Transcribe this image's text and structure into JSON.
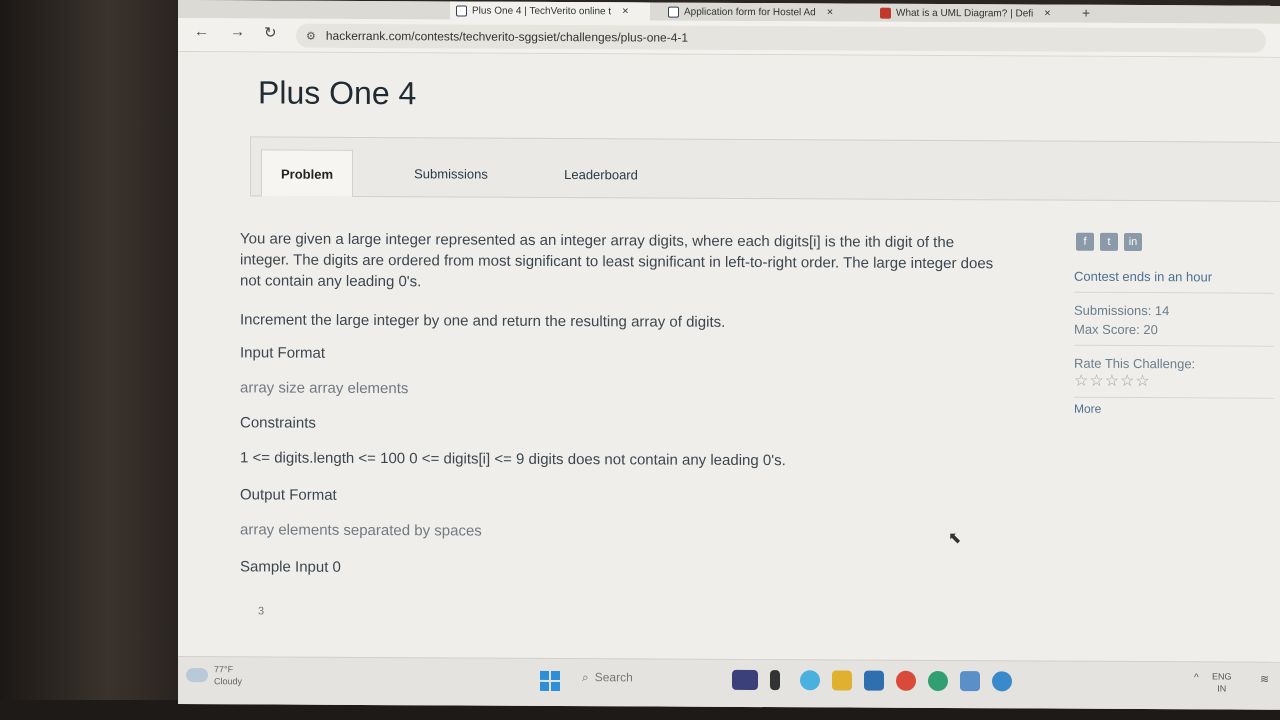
{
  "browser": {
    "tabs": [
      {
        "title": "Plus One 4 | TechVerito online t",
        "active": true
      },
      {
        "title": "Application form for Hostel Ad",
        "active": false
      },
      {
        "title": "What is a UML Diagram? | Defi",
        "active": false
      }
    ],
    "new_tab_label": "+",
    "close_glyph": "×",
    "url": "hackerrank.com/contests/techverito-sggsiet/challenges/plus-one-4-1"
  },
  "page": {
    "title": "Plus One 4",
    "tabs": [
      {
        "label": "Problem",
        "active": true
      },
      {
        "label": "Submissions",
        "active": false
      },
      {
        "label": "Leaderboard",
        "active": false
      }
    ],
    "description": "You are given a large integer represented as an integer array digits, where each digits[i] is the ith digit of the integer. The digits are ordered from most significant to least significant in left-to-right order. The large integer does not contain any leading 0's.",
    "task": "Increment the large integer by one and return the resulting array of digits.",
    "input_format_heading": "Input Format",
    "input_format_text": "array size array elements",
    "constraints_heading": "Constraints",
    "constraints_text": "1 <= digits.length <= 100 0 <= digits[i] <= 9 digits does not contain any leading 0's.",
    "output_format_heading": "Output Format",
    "output_format_text": "array elements separated by spaces",
    "sample_input_heading": "Sample Input 0",
    "sample_input_value": "3"
  },
  "sidebar": {
    "social_icons": [
      "facebook-icon",
      "twitter-icon",
      "linkedin-icon"
    ],
    "contest_ends": "Contest ends in an hour",
    "submissions": "Submissions: 14",
    "max_score": "Max Score: 20",
    "rate_label": "Rate This Challenge:",
    "stars": "☆☆☆☆☆",
    "more_link": "More"
  },
  "taskbar": {
    "temperature": "77°F",
    "weather": "Cloudy",
    "search_placeholder": "Search",
    "language": "ENG",
    "region": "IN"
  },
  "colors": {
    "page_bg": "#efeeea",
    "title": "#1f2a33",
    "link": "#4d7090",
    "windows_blue": "#2c8fd8"
  }
}
